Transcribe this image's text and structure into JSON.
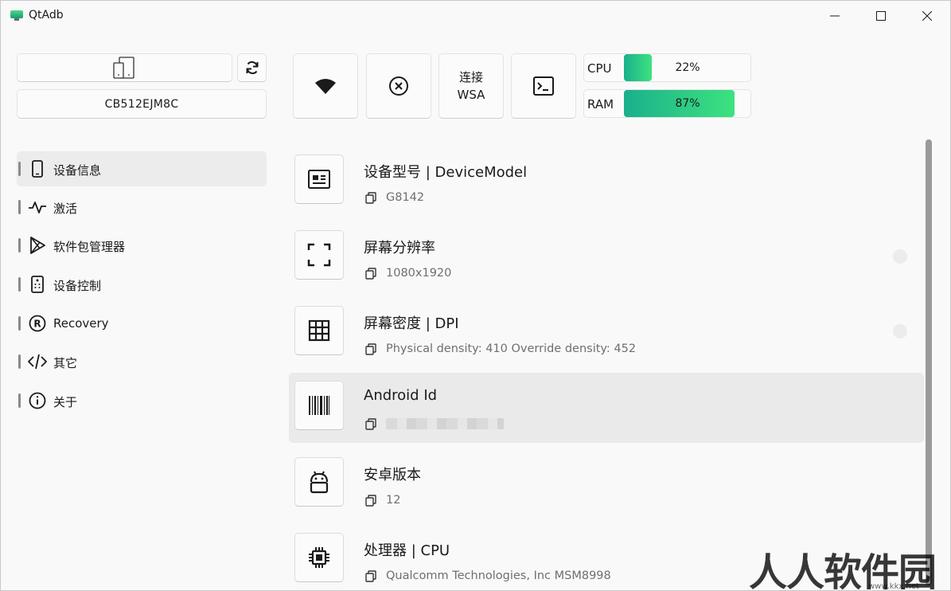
{
  "window": {
    "title": "QtAdb"
  },
  "device": {
    "serial": "CB512EJM8C"
  },
  "toolbar": {
    "wsa_label_line1": "连接",
    "wsa_label_line2": "WSA"
  },
  "meters": {
    "cpu": {
      "label": "CPU",
      "value_text": "22%",
      "fraction": 0.22
    },
    "ram": {
      "label": "RAM",
      "value_text": "87%",
      "fraction": 0.87
    }
  },
  "sidebar": {
    "items": [
      {
        "label": "设备信息",
        "icon": "phone-icon",
        "selected": true
      },
      {
        "label": "激活",
        "icon": "pulse-icon"
      },
      {
        "label": "软件包管理器",
        "icon": "play-store-icon"
      },
      {
        "label": "设备控制",
        "icon": "remote-icon"
      },
      {
        "label": "Recovery",
        "icon": "registered-icon"
      },
      {
        "label": "其它",
        "icon": "code-icon"
      },
      {
        "label": "关于",
        "icon": "info-icon"
      }
    ]
  },
  "info": {
    "rows": [
      {
        "title": "设备型号 | DeviceModel",
        "value": "G8142",
        "icon": "id-card-icon"
      },
      {
        "title": "屏幕分辨率",
        "value": "1080x1920",
        "icon": "fullscreen-icon"
      },
      {
        "title": "屏幕密度 | DPI",
        "value": "Physical density: 410 Override density: 452",
        "icon": "grid-icon"
      },
      {
        "title": "Android Id",
        "value": "",
        "icon": "barcode-icon"
      },
      {
        "title": "安卓版本",
        "value": "12",
        "icon": "android-icon"
      },
      {
        "title": "处理器 | CPU",
        "value": "Qualcomm Technologies, Inc MSM8998",
        "icon": "chip-icon"
      }
    ]
  },
  "watermark": {
    "text": "人人软件园",
    "url": "www.kkx.net"
  },
  "colors": {
    "accent_start": "#1ab08c",
    "accent_end": "#3de27f",
    "window_bg": "#f9f9f9"
  }
}
